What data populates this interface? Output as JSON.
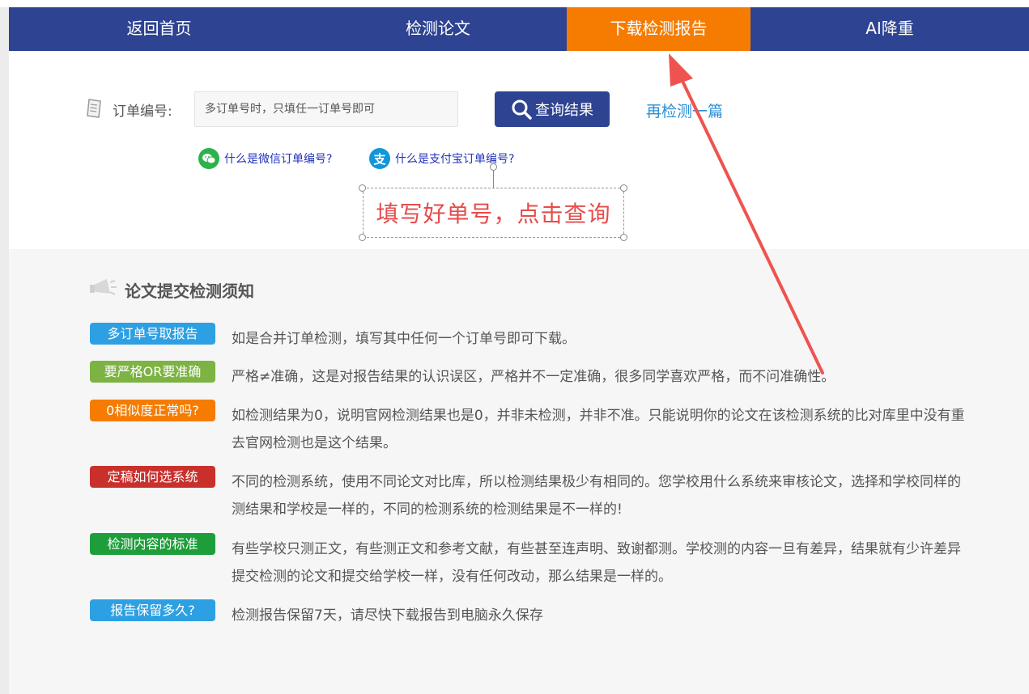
{
  "nav": {
    "items": [
      {
        "label": "返回首页"
      },
      {
        "label": "检测论文"
      },
      {
        "label": "下载检测报告"
      },
      {
        "label": "AI降重"
      }
    ]
  },
  "search": {
    "label": "订单编号:",
    "placeholder": "多订单号时，只填任一订单号即可",
    "query_button": "查询结果",
    "recheck_link": "再检测一篇",
    "wechat_help": "什么是微信订单编号?",
    "alipay_help": "什么是支付宝订单编号?"
  },
  "annotation": {
    "text": "填写好单号，点击查询"
  },
  "notice": {
    "title": "论文提交检测须知",
    "items": [
      {
        "tag": "多订单号取报告",
        "color": "#2da0e3",
        "lines": [
          "如是合并订单检测，填写其中任何一个订单号即可下载。"
        ]
      },
      {
        "tag": "要严格OR要准确",
        "color": "#7cb342",
        "lines": [
          "严格≠准确，这是对报告结果的认识误区，严格并不一定准确，很多同学喜欢严格，而不问准确性。"
        ]
      },
      {
        "tag": "0相似度正常吗?",
        "color": "#f57c00",
        "lines": [
          "如检测结果为0，说明官网检测结果也是0，并非未检测，并非不准。只能说明你的论文在该检测系统的比对库里中没有重",
          "去官网检测也是这个结果。"
        ]
      },
      {
        "tag": "定稿如何选系统",
        "color": "#c9302c",
        "lines": [
          "不同的检测系统，使用不同论文对比库，所以检测结果极少有相同的。您学校用什么系统来审核论文，选择和学校同样的",
          "测结果和学校是一样的，不同的检测系统的检测结果是不一样的!"
        ]
      },
      {
        "tag": "检测内容的标准",
        "color": "#1e9e3a",
        "lines": [
          "有些学校只测正文，有些测正文和参考文献，有些甚至连声明、致谢都测。学校测的内容一旦有差异，结果就有少许差异",
          "提交检测的论文和提交给学校一样，没有任何改动，那么结果是一样的。"
        ]
      },
      {
        "tag": "报告保留多久?",
        "color": "#2da0e3",
        "lines": [
          "检测报告保留7天，请尽快下载报告到电脑永久保存"
        ]
      }
    ]
  },
  "colors": {
    "nav_bg": "#2e4391",
    "active_tab": "#f57c00",
    "link": "#2b8fd8",
    "annotation_red": "#e74b4b",
    "wechat": "#2bb24c",
    "alipay": "#1296db"
  },
  "icons": {
    "search": "search-icon",
    "document": "document-icon",
    "wechat": "wechat-icon",
    "alipay": "alipay-icon",
    "megaphone": "megaphone-icon",
    "arrow": "annotation-arrow"
  }
}
